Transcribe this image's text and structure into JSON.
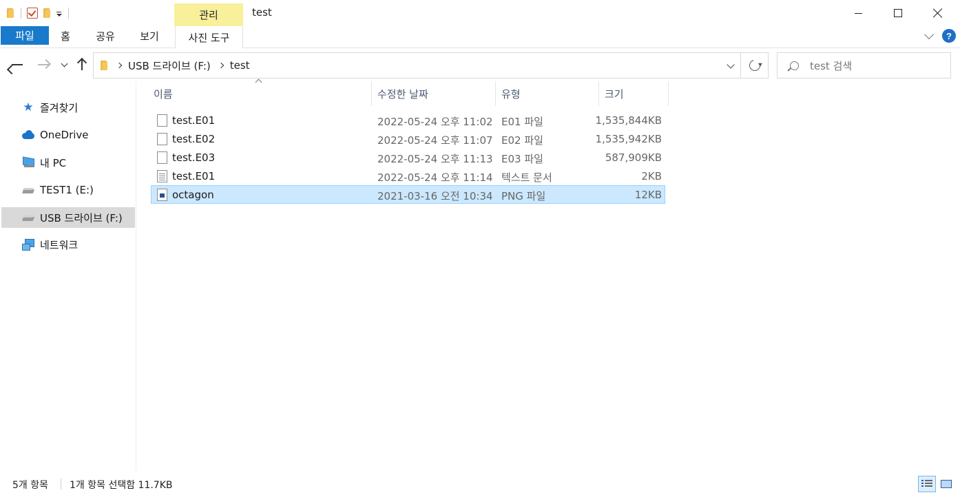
{
  "window": {
    "title": "test",
    "contextual_tab_group": "관리"
  },
  "ribbon": {
    "tabs": [
      {
        "label": "파일",
        "active": true
      },
      {
        "label": "홈"
      },
      {
        "label": "공유"
      },
      {
        "label": "보기"
      },
      {
        "label": "사진 도구"
      }
    ],
    "help_label": "?"
  },
  "address": {
    "breadcrumbs": [
      "USB 드라이브 (F:)",
      "test"
    ],
    "search_placeholder": "test 검색"
  },
  "sidebar": {
    "items": [
      {
        "label": "즐겨찾기",
        "icon": "star-icon"
      },
      {
        "label": "OneDrive",
        "icon": "cloud-icon"
      },
      {
        "label": "내 PC",
        "icon": "pc-icon"
      },
      {
        "label": "TEST1 (E:)",
        "icon": "drive-icon"
      },
      {
        "label": "USB 드라이브 (F:)",
        "icon": "drive-icon",
        "selected": true
      },
      {
        "label": "네트워크",
        "icon": "network-icon"
      }
    ]
  },
  "columns": {
    "name": "이름",
    "date": "수정한 날짜",
    "type": "유형",
    "size": "크기"
  },
  "files": [
    {
      "name": "test.E01",
      "date": "2022-05-24 오후 11:02",
      "type": "E01 파일",
      "size": "1,535,844KB",
      "icon": "file-icon"
    },
    {
      "name": "test.E02",
      "date": "2022-05-24 오후 11:07",
      "type": "E02 파일",
      "size": "1,535,942KB",
      "icon": "file-icon"
    },
    {
      "name": "test.E03",
      "date": "2022-05-24 오후 11:13",
      "type": "E03 파일",
      "size": "587,909KB",
      "icon": "file-icon"
    },
    {
      "name": "test.E01",
      "date": "2022-05-24 오후 11:14",
      "type": "텍스트 문서",
      "size": "2KB",
      "icon": "text-file-icon"
    },
    {
      "name": "octagon",
      "date": "2021-03-16 오전 10:34",
      "type": "PNG 파일",
      "size": "12KB",
      "icon": "image-file-icon",
      "selected": true
    }
  ],
  "status": {
    "item_count": "5개 항목",
    "selection": "1개 항목 선택함 11.7KB"
  }
}
